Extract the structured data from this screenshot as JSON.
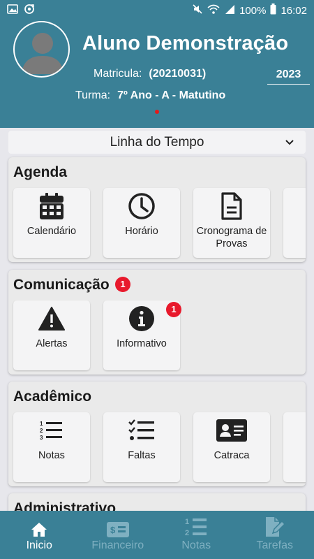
{
  "status_bar": {
    "battery": "100%",
    "time": "16:02"
  },
  "header": {
    "student_name": "Aluno Demonstração",
    "matricula_label": "Matricula:",
    "matricula_value": "(20210031)",
    "year": "2023",
    "turma_label": "Turma:",
    "turma_value": "7º Ano - A - Matutino"
  },
  "timeline": {
    "label": "Linha do Tempo"
  },
  "sections": {
    "agenda": {
      "title": "Agenda",
      "items": [
        "Calendário",
        "Horário",
        "Cronograma de Provas"
      ]
    },
    "comunicacao": {
      "title": "Comunicação",
      "badge": "1",
      "items": [
        "Alertas",
        "Informativo"
      ],
      "informativo_badge": "1"
    },
    "academico": {
      "title": "Acadêmico",
      "items": [
        "Notas",
        "Faltas",
        "Catraca"
      ]
    },
    "administrativo": {
      "title": "Administrativo"
    }
  },
  "bottom_nav": [
    "Inicio",
    "Financeiro",
    "Notas",
    "Tarefas"
  ],
  "colors": {
    "primary": "#3a8096",
    "badge": "#e8192c",
    "inactive_nav": "#7fb0c1"
  }
}
